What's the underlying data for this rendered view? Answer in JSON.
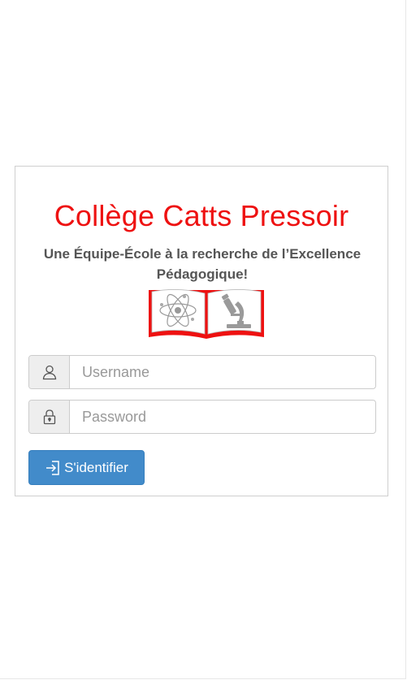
{
  "header": {
    "school_name": "Collège Catts Pressoir",
    "motto": "Une Équipe-École à la recherche de l’Excellence Pédagogique!"
  },
  "logo": {
    "icon": "open-book-science-logo",
    "accent_color": "#ee1111"
  },
  "form": {
    "username": {
      "icon": "user-icon",
      "placeholder": "Username",
      "value": ""
    },
    "password": {
      "icon": "lock-icon",
      "placeholder": "Password",
      "value": ""
    },
    "submit": {
      "icon": "sign-in-icon",
      "label": "S'identifier",
      "color": "#428bca"
    }
  }
}
